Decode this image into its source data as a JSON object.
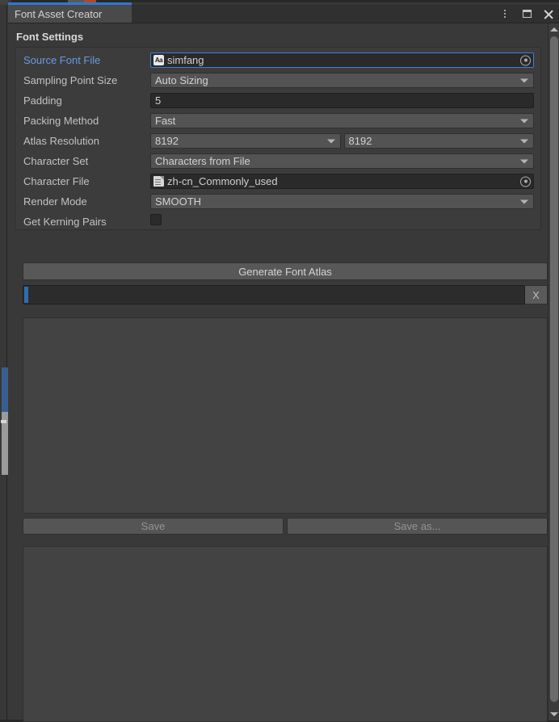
{
  "window": {
    "tab_label": "Font Asset Creator",
    "accent_color": "#2c79d4",
    "controls": {
      "menu": "kebab-menu-icon",
      "maximize": "maximize-icon",
      "close": "close-icon"
    }
  },
  "font_settings": {
    "section_title": "Font Settings",
    "rows": [
      {
        "label": "Source Font File",
        "value": "simfang",
        "kind": "object",
        "icon": "font-asset-icon",
        "highlighted": true
      },
      {
        "label": "Sampling Point Size",
        "value": "Auto Sizing",
        "kind": "dropdown"
      },
      {
        "label": "Padding",
        "value": "5",
        "kind": "text"
      },
      {
        "label": "Packing Method",
        "value": "Fast",
        "kind": "dropdown"
      },
      {
        "label": "Atlas Resolution",
        "value": "8192",
        "value2": "8192",
        "kind": "dropdown-pair"
      },
      {
        "label": "Character Set",
        "value": "Characters from File",
        "kind": "dropdown"
      },
      {
        "label": "Character File",
        "value": "zh-cn_Commonly_used",
        "kind": "object",
        "icon": "text-asset-icon"
      },
      {
        "label": "Render Mode",
        "value": "SMOOTH",
        "kind": "dropdown"
      },
      {
        "label": "Get Kerning Pairs",
        "value": "",
        "kind": "checkbox",
        "checked": false
      }
    ]
  },
  "actions": {
    "generate_label": "Generate Font Atlas",
    "progress_cancel_label": "X",
    "progress_percent": 1,
    "save_label": "Save",
    "save_as_label": "Save as...",
    "save_enabled": false
  },
  "scrollbar": {
    "up_arrow": "scroll-up-arrow-icon",
    "down_arrow": "scroll-down-arrow-icon"
  }
}
